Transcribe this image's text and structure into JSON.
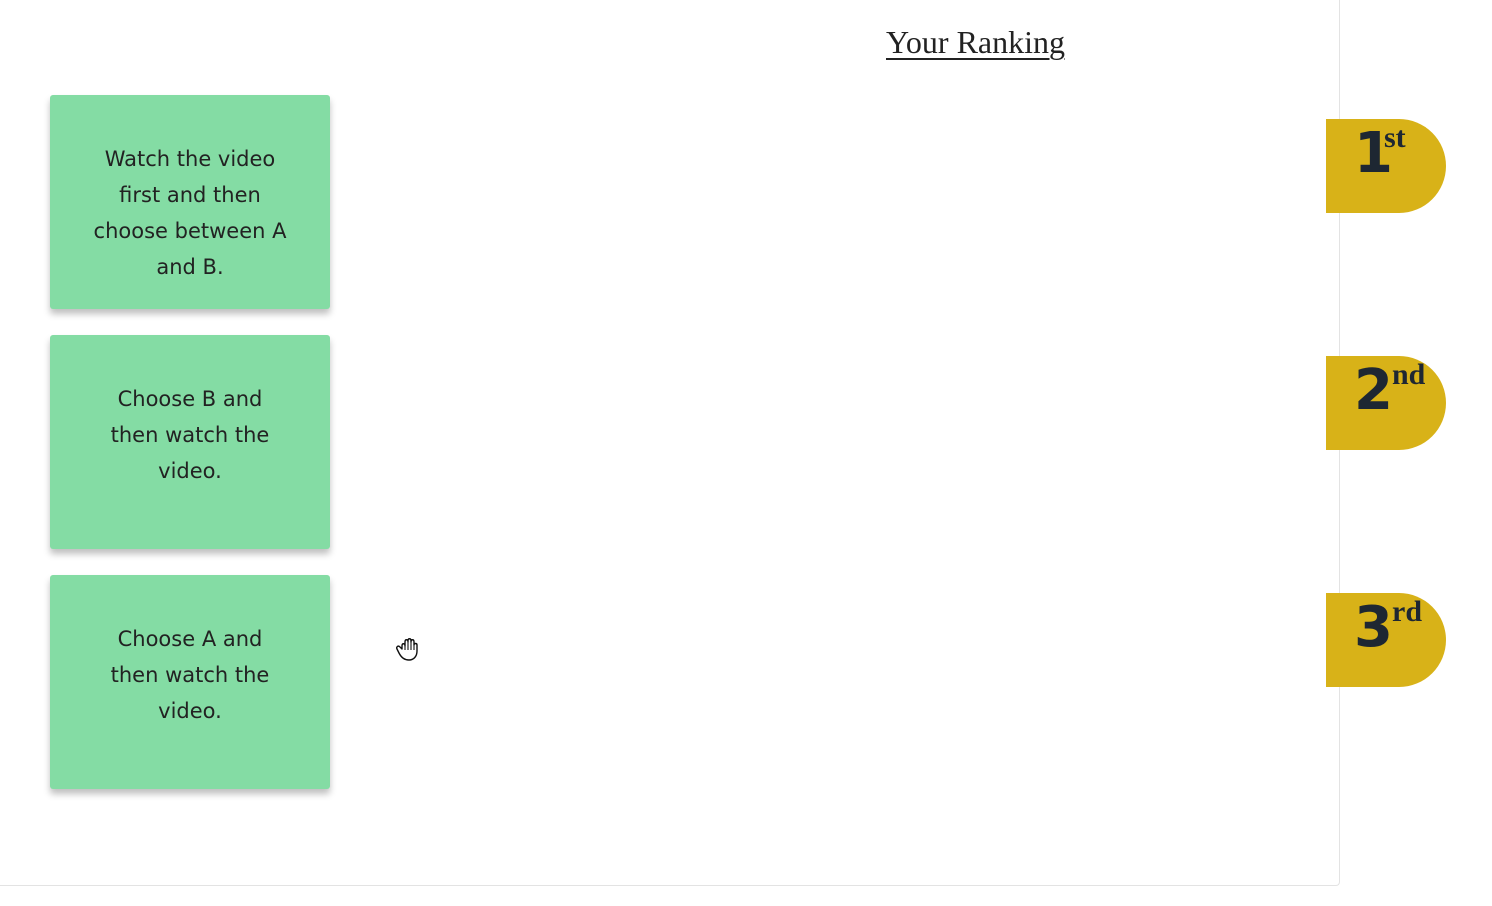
{
  "ranking": {
    "title": "Your Ranking"
  },
  "cards": [
    {
      "text": "Watch the video first and then choose between A and B.",
      "lines": [
        "Watch the video",
        "first and then",
        "choose between A",
        "and B."
      ]
    },
    {
      "text": "Choose B and then watch the video.",
      "lines": [
        "Choose B and",
        "then watch the",
        "video."
      ]
    },
    {
      "text": "Choose A and then watch the video.",
      "lines": [
        "Choose A and",
        "then watch the",
        "video."
      ]
    }
  ],
  "badges": [
    {
      "number": "1",
      "suffix": "st"
    },
    {
      "number": "2",
      "suffix": "nd"
    },
    {
      "number": "3",
      "suffix": "rd"
    }
  ],
  "colors": {
    "card": "#84dca4",
    "badge": "#d8b218",
    "badge_text": "#1e2732"
  },
  "cursor": {
    "icon": "grab-hand-icon"
  }
}
